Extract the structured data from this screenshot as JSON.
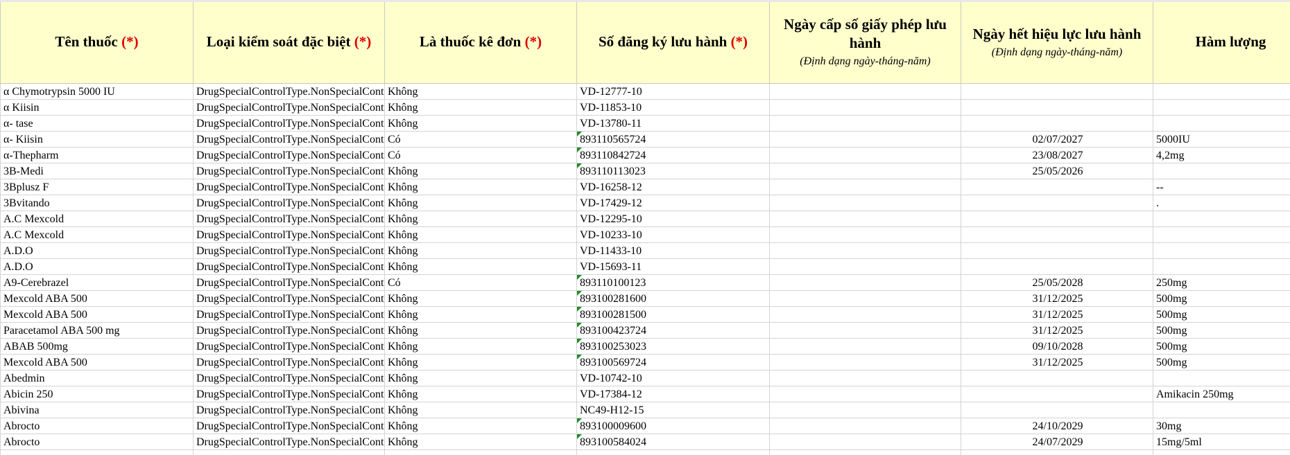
{
  "columns": [
    {
      "label": "Tên thuốc",
      "required": "(*)",
      "hint": ""
    },
    {
      "label": "Loại kiểm soát đặc biệt",
      "required": "(*)",
      "hint": ""
    },
    {
      "label": "Là thuốc kê đơn",
      "required": "(*)",
      "hint": ""
    },
    {
      "label": "Số đăng ký lưu hành",
      "required": "(*)",
      "hint": ""
    },
    {
      "label": "Ngày cấp số giấy phép lưu hành",
      "required": "",
      "hint": "(Định dạng ngày-tháng-năm)"
    },
    {
      "label": "Ngày hết hiệu lực lưu hành",
      "required": "",
      "hint": "(Định dạng ngày-tháng-năm)"
    },
    {
      "label": "Hàm lượng",
      "required": "",
      "hint": ""
    }
  ],
  "rows": [
    {
      "name": "α Chymotrypsin 5000 IU",
      "control": "DrugSpecialControlType.NonSpecialControl",
      "rx": "Không",
      "reg": "VD-12777-10",
      "issue": "",
      "expiry": "",
      "strength": ""
    },
    {
      "name": "α Kiisin",
      "control": "DrugSpecialControlType.NonSpecialControl",
      "rx": "Không",
      "reg": "VD-11853-10",
      "issue": "",
      "expiry": "",
      "strength": ""
    },
    {
      "name": "α- tase",
      "control": "DrugSpecialControlType.NonSpecialControl",
      "rx": "Không",
      "reg": "VD-13780-11",
      "issue": "",
      "expiry": "",
      "strength": ""
    },
    {
      "name": "α- Kiisin",
      "control": "DrugSpecialControlType.NonSpecialControl",
      "rx": "Có",
      "reg": "893110565724",
      "issue": "",
      "expiry": "02/07/2027",
      "strength": "5000IU"
    },
    {
      "name": "α-Thepharm",
      "control": "DrugSpecialControlType.NonSpecialControl",
      "rx": "Có",
      "reg": "893110842724",
      "issue": "",
      "expiry": "23/08/2027",
      "strength": "4,2mg"
    },
    {
      "name": "3B-Medi",
      "control": "DrugSpecialControlType.NonSpecialControl",
      "rx": "Không",
      "reg": "893110113023",
      "issue": "",
      "expiry": "25/05/2026",
      "strength": ""
    },
    {
      "name": "3Bplusz F",
      "control": "DrugSpecialControlType.NonSpecialControl",
      "rx": "Không",
      "reg": "VD-16258-12",
      "issue": "",
      "expiry": "",
      "strength": "--"
    },
    {
      "name": "3Bvitando",
      "control": "DrugSpecialControlType.NonSpecialControl",
      "rx": "Không",
      "reg": "VD-17429-12",
      "issue": "",
      "expiry": "",
      "strength": "."
    },
    {
      "name": "A.C Mexcold",
      "control": "DrugSpecialControlType.NonSpecialControl",
      "rx": "Không",
      "reg": "VD-12295-10",
      "issue": "",
      "expiry": "",
      "strength": ""
    },
    {
      "name": "A.C Mexcold",
      "control": "DrugSpecialControlType.NonSpecialControl",
      "rx": "Không",
      "reg": "VD-10233-10",
      "issue": "",
      "expiry": "",
      "strength": ""
    },
    {
      "name": "A.D.O",
      "control": "DrugSpecialControlType.NonSpecialControl",
      "rx": "Không",
      "reg": "VD-11433-10",
      "issue": "",
      "expiry": "",
      "strength": ""
    },
    {
      "name": "A.D.O",
      "control": "DrugSpecialControlType.NonSpecialControl",
      "rx": "Không",
      "reg": "VD-15693-11",
      "issue": "",
      "expiry": "",
      "strength": ""
    },
    {
      "name": "A9-Cerebrazel",
      "control": "DrugSpecialControlType.NonSpecialControl",
      "rx": "Có",
      "reg": "893110100123",
      "issue": "",
      "expiry": "25/05/2028",
      "strength": "250mg"
    },
    {
      "name": "Mexcold ABA 500",
      "control": "DrugSpecialControlType.NonSpecialControl",
      "rx": "Không",
      "reg": "893100281600",
      "issue": "",
      "expiry": "31/12/2025",
      "strength": "500mg"
    },
    {
      "name": "Mexcold ABA 500",
      "control": "DrugSpecialControlType.NonSpecialControl",
      "rx": "Không",
      "reg": "893100281500",
      "issue": "",
      "expiry": "31/12/2025",
      "strength": "500mg"
    },
    {
      "name": "Paracetamol ABA 500 mg",
      "control": "DrugSpecialControlType.NonSpecialControl",
      "rx": "Không",
      "reg": "893100423724",
      "issue": "",
      "expiry": "31/12/2025",
      "strength": "500mg"
    },
    {
      "name": "ABAB 500mg",
      "control": "DrugSpecialControlType.NonSpecialControl",
      "rx": "Không",
      "reg": "893100253023",
      "issue": "",
      "expiry": "09/10/2028",
      "strength": "500mg"
    },
    {
      "name": "Mexcold ABA 500",
      "control": "DrugSpecialControlType.NonSpecialControl",
      "rx": "Không",
      "reg": "893100569724",
      "issue": "",
      "expiry": "31/12/2025",
      "strength": "500mg"
    },
    {
      "name": "Abedmin",
      "control": "DrugSpecialControlType.NonSpecialControl",
      "rx": "Không",
      "reg": "VD-10742-10",
      "issue": "",
      "expiry": "",
      "strength": ""
    },
    {
      "name": "Abicin 250",
      "control": "DrugSpecialControlType.NonSpecialControl",
      "rx": "Không",
      "reg": "VD-17384-12",
      "issue": "",
      "expiry": "",
      "strength": "Amikacin 250mg"
    },
    {
      "name": "Abivina",
      "control": "DrugSpecialControlType.NonSpecialControl",
      "rx": "Không",
      "reg": "NC49-H12-15",
      "issue": "",
      "expiry": "",
      "strength": ""
    },
    {
      "name": "Abrocto",
      "control": "DrugSpecialControlType.NonSpecialControl",
      "rx": "Không",
      "reg": "893100009600",
      "issue": "",
      "expiry": "24/10/2029",
      "strength": "30mg"
    },
    {
      "name": "Abrocto",
      "control": "DrugSpecialControlType.NonSpecialControl",
      "rx": "Không",
      "reg": "893100584024",
      "issue": "",
      "expiry": "24/07/2029",
      "strength": "15mg/5ml"
    },
    {
      "name": "",
      "control": "",
      "rx": "",
      "reg": "",
      "issue": "",
      "expiry": "",
      "strength": ""
    }
  ]
}
